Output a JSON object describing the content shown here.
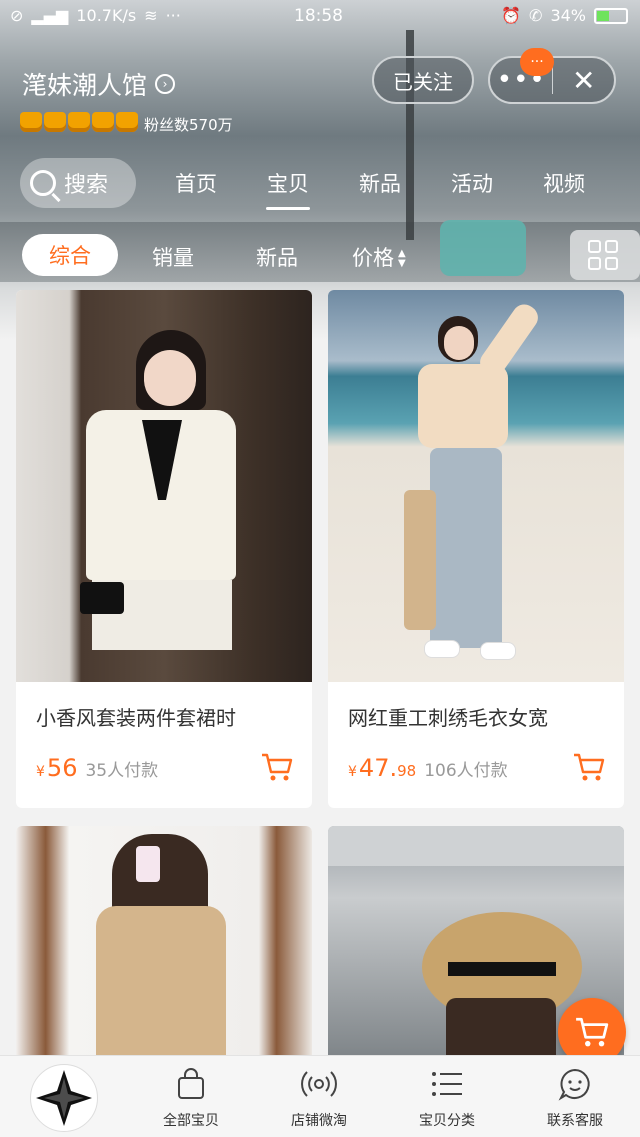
{
  "status_bar": {
    "network_speed": "10.7K/s",
    "time": "18:58",
    "battery": "34%"
  },
  "shop": {
    "name": "滗妹潮人馆",
    "fans_label": "粉丝数570万",
    "follow_label": "已关注",
    "badge": "···"
  },
  "nav": {
    "search_label": "搜索",
    "tabs": [
      "首页",
      "宝贝",
      "新品",
      "活动",
      "视频"
    ]
  },
  "sort": {
    "items": [
      "综合",
      "销量",
      "新品",
      "价格"
    ]
  },
  "products": [
    {
      "title": "小香风套装两件套裙时",
      "currency": "¥",
      "price_int": "56",
      "price_dec": "",
      "sold": "35人付款"
    },
    {
      "title": "网红重工刺绣毛衣女宽",
      "currency": "¥",
      "price_int": "47.",
      "price_dec": "98",
      "sold": "106人付款"
    }
  ],
  "bottom_bar": {
    "items": [
      "全部宝贝",
      "店铺微淘",
      "宝贝分类",
      "联系客服"
    ]
  },
  "colors": {
    "accent": "#ff6d1f"
  },
  "icons": [
    "search-icon",
    "close-icon",
    "more-icon",
    "grid-icon",
    "cart-icon",
    "bag-icon",
    "broadcast-icon",
    "list-icon",
    "chat-icon",
    "star-logo-icon"
  ]
}
